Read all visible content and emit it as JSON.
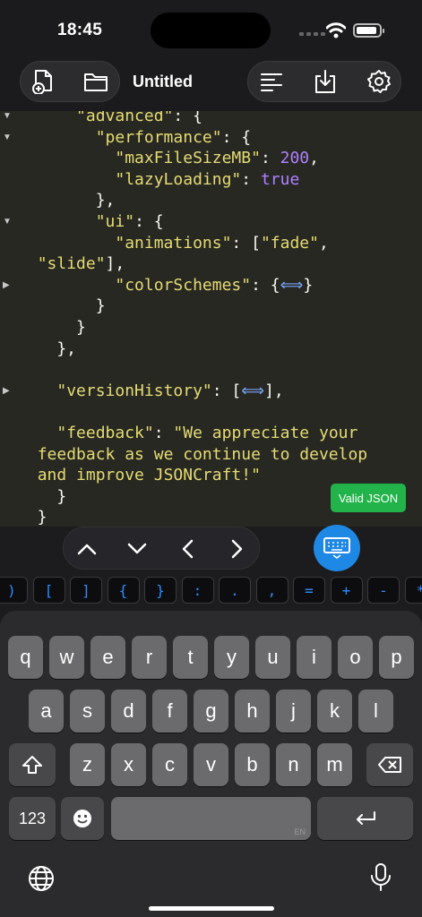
{
  "status": {
    "time": "18:45"
  },
  "toolbar": {
    "title": "Untitled",
    "buttons": [
      "new-file",
      "open-folder",
      "format",
      "save-download",
      "settings"
    ]
  },
  "editor": {
    "lines": [
      [
        {
          "t": "      ",
          "c": "p"
        },
        {
          "t": "\"advanced\"",
          "c": "k"
        },
        {
          "t": ": {",
          "c": "p"
        }
      ],
      [
        {
          "t": "        ",
          "c": "p"
        },
        {
          "t": "\"performance\"",
          "c": "k"
        },
        {
          "t": ": {",
          "c": "p"
        }
      ],
      [
        {
          "t": "          ",
          "c": "p"
        },
        {
          "t": "\"maxFileSizeMB\"",
          "c": "k"
        },
        {
          "t": ": ",
          "c": "p"
        },
        {
          "t": "200",
          "c": "n"
        },
        {
          "t": ",",
          "c": "p"
        }
      ],
      [
        {
          "t": "          ",
          "c": "p"
        },
        {
          "t": "\"lazyLoading\"",
          "c": "k"
        },
        {
          "t": ": ",
          "c": "p"
        },
        {
          "t": "true",
          "c": "n"
        }
      ],
      [
        {
          "t": "        },",
          "c": "p"
        }
      ],
      [
        {
          "t": "        ",
          "c": "p"
        },
        {
          "t": "\"ui\"",
          "c": "k"
        },
        {
          "t": ": {",
          "c": "p"
        }
      ],
      [
        {
          "t": "          ",
          "c": "p"
        },
        {
          "t": "\"animations\"",
          "c": "k"
        },
        {
          "t": ": [",
          "c": "p"
        },
        {
          "t": "\"fade\"",
          "c": "s"
        },
        {
          "t": ",",
          "c": "p"
        }
      ],
      [
        {
          "t": "  ",
          "c": "p"
        },
        {
          "t": "\"slide\"",
          "c": "s"
        },
        {
          "t": "],",
          "c": "p"
        }
      ],
      [
        {
          "t": "          ",
          "c": "p"
        },
        {
          "t": "\"colorSchemes\"",
          "c": "k"
        },
        {
          "t": ": {",
          "c": "p"
        },
        {
          "t": "⟺",
          "c": "col"
        },
        {
          "t": "}",
          "c": "p"
        }
      ],
      [
        {
          "t": "        }",
          "c": "p"
        }
      ],
      [
        {
          "t": "      }",
          "c": "p"
        }
      ],
      [
        {
          "t": "    },",
          "c": "p"
        }
      ],
      [
        {
          "t": "",
          "c": "p"
        }
      ],
      [
        {
          "t": "    ",
          "c": "p"
        },
        {
          "t": "\"versionHistory\"",
          "c": "k"
        },
        {
          "t": ": [",
          "c": "p"
        },
        {
          "t": "⟺",
          "c": "col"
        },
        {
          "t": "],",
          "c": "p"
        }
      ],
      [
        {
          "t": "",
          "c": "p"
        }
      ],
      [
        {
          "t": "    ",
          "c": "p"
        },
        {
          "t": "\"feedback\"",
          "c": "k"
        },
        {
          "t": ": ",
          "c": "p"
        },
        {
          "t": "\"We appreciate your",
          "c": "s"
        }
      ],
      [
        {
          "t": "  ",
          "c": "p"
        },
        {
          "t": "feedback as we continue to develop",
          "c": "s"
        }
      ],
      [
        {
          "t": "  ",
          "c": "p"
        },
        {
          "t": "and improve JSONCraft!\"",
          "c": "s"
        }
      ],
      [
        {
          "t": "    }",
          "c": "p"
        }
      ],
      [
        {
          "t": "  }",
          "c": "p"
        }
      ]
    ],
    "folds": [
      "▼",
      "▼",
      "",
      "",
      "",
      "▼",
      "",
      "",
      "▶",
      "",
      "",
      "",
      "",
      "▶",
      "",
      "",
      "",
      "",
      "",
      ""
    ],
    "valid_label": "Valid JSON"
  },
  "symbols": [
    ")",
    "[",
    "]",
    "{",
    "}",
    ":",
    ".",
    ",",
    "=",
    "+",
    "-",
    "*"
  ],
  "keyboard": {
    "row1": [
      "q",
      "w",
      "e",
      "r",
      "t",
      "y",
      "u",
      "i",
      "o",
      "p"
    ],
    "row2": [
      "a",
      "s",
      "d",
      "f",
      "g",
      "h",
      "j",
      "k",
      "l"
    ],
    "row3": [
      "z",
      "x",
      "c",
      "v",
      "b",
      "n",
      "m"
    ],
    "numbers_label": "123",
    "space_lang": "EN"
  },
  "colors": {
    "accent": "#1e88e5",
    "valid": "#22b34a",
    "editor_bg": "#272822",
    "key_string": "#e6db74",
    "literal": "#ae81ff"
  }
}
